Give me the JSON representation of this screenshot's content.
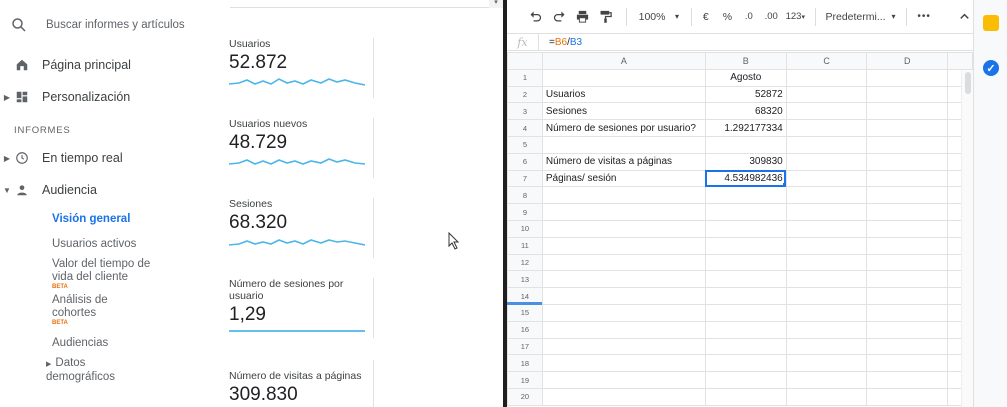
{
  "analytics": {
    "search_placeholder": "Buscar informes y artículos",
    "nav": {
      "home": "Página principal",
      "customization": "Personalización",
      "section_label": "INFORMES",
      "realtime": "En tiempo real",
      "audience": "Audiencia",
      "audience_items": [
        {
          "label": "Visión general"
        },
        {
          "label": "Usuarios activos"
        },
        {
          "label": "Valor del tiempo de vida del cliente",
          "badge": "BETA"
        },
        {
          "label": "Análisis de cohortes",
          "badge": "BETA"
        },
        {
          "label": "Audiencias"
        },
        {
          "label": "Datos demográficos"
        }
      ]
    },
    "metrics": [
      {
        "label": "Usuarios",
        "value": "52.872"
      },
      {
        "label": "Usuarios nuevos",
        "value": "48.729"
      },
      {
        "label": "Sesiones",
        "value": "68.320"
      },
      {
        "label": "Número de sesiones por usuario",
        "value": "1,29"
      },
      {
        "label": "Número de visitas a páginas",
        "value": "309.830"
      }
    ],
    "colors": {
      "accent": "#1a73e8",
      "spark": "#4db6e8",
      "beta": "#e8710a"
    }
  },
  "sheets": {
    "toolbar": {
      "zoom": "100%",
      "currency": "€",
      "percent": "%",
      "decrease_decimals": ".0",
      "increase_decimals": ".00",
      "more_formats": "123",
      "font": "Predetermi...",
      "more": "•••"
    },
    "formula_bar": {
      "fx": "fx",
      "formula_eq": "=",
      "formula_ref1": "B6",
      "formula_op": "/",
      "formula_ref2": "B3"
    },
    "columns": [
      "A",
      "B",
      "C",
      "D"
    ],
    "rows": [
      {
        "n": "1",
        "a": "",
        "b": "Agosto"
      },
      {
        "n": "2",
        "a": "Usuarios",
        "b": "52872"
      },
      {
        "n": "3",
        "a": "Sesiones",
        "b": "68320"
      },
      {
        "n": "4",
        "a": "Número de sesiones por usuario?",
        "b": "1.292177334"
      },
      {
        "n": "5",
        "a": "",
        "b": ""
      },
      {
        "n": "6",
        "a": "Número de visitas a páginas",
        "b": "309830"
      },
      {
        "n": "7",
        "a": "Páginas/ sesión",
        "b": "4.534982436"
      },
      {
        "n": "8",
        "a": "",
        "b": ""
      },
      {
        "n": "9",
        "a": "",
        "b": ""
      },
      {
        "n": "10",
        "a": "",
        "b": ""
      },
      {
        "n": "11",
        "a": "",
        "b": ""
      },
      {
        "n": "12",
        "a": "",
        "b": ""
      },
      {
        "n": "13",
        "a": "",
        "b": ""
      },
      {
        "n": "14",
        "a": "",
        "b": ""
      },
      {
        "n": "15",
        "a": "",
        "b": ""
      },
      {
        "n": "16",
        "a": "",
        "b": ""
      },
      {
        "n": "17",
        "a": "",
        "b": ""
      },
      {
        "n": "18",
        "a": "",
        "b": ""
      },
      {
        "n": "19",
        "a": "",
        "b": ""
      },
      {
        "n": "20",
        "a": "",
        "b": ""
      }
    ],
    "colors": {
      "selection": "#1a73e8",
      "ref1": "#e8710a",
      "ref2": "#1a73e8"
    }
  }
}
